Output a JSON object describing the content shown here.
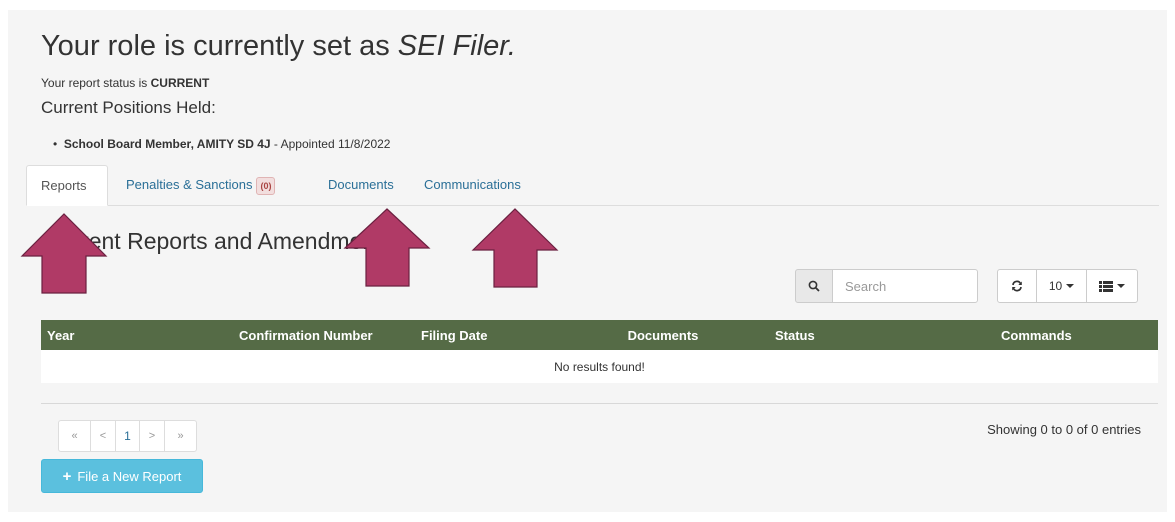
{
  "header": {
    "title_prefix": "Your role is currently set as ",
    "role": "SEI Filer.",
    "status_prefix": "Your report status is ",
    "status_value": "CURRENT",
    "positions_heading": "Current Positions Held:",
    "position": {
      "name": "School Board Member, AMITY SD 4J",
      "suffix": " - Appointed 11/8/2022"
    }
  },
  "tabs": [
    {
      "label": "Reports"
    },
    {
      "label": "Penalties & Sanctions",
      "badge": "(0)"
    },
    {
      "label": "Documents"
    },
    {
      "label": "Communications"
    }
  ],
  "section_heading": "Current Reports and Amendments",
  "toolbar": {
    "search_placeholder": "Search",
    "page_size": "10"
  },
  "table": {
    "columns": [
      "Year",
      "Confirmation Number",
      "Filing Date",
      "Documents",
      "Status",
      "Commands"
    ],
    "empty_message": "No results found!"
  },
  "pagination": {
    "first": "«",
    "prev": "<",
    "current": "1",
    "next": ">",
    "last": "»",
    "summary": "Showing 0 to 0 of 0 entries"
  },
  "new_report_label": "File a New Report",
  "colors": {
    "table_header": "#556b46",
    "arrow_fill": "#b03a66",
    "button_info": "#5bc0de",
    "badge_bg": "#f2dede"
  },
  "icons": [
    "search-icon",
    "refresh-icon",
    "columns-icon",
    "plus-icon",
    "arrow-up-annotation"
  ]
}
